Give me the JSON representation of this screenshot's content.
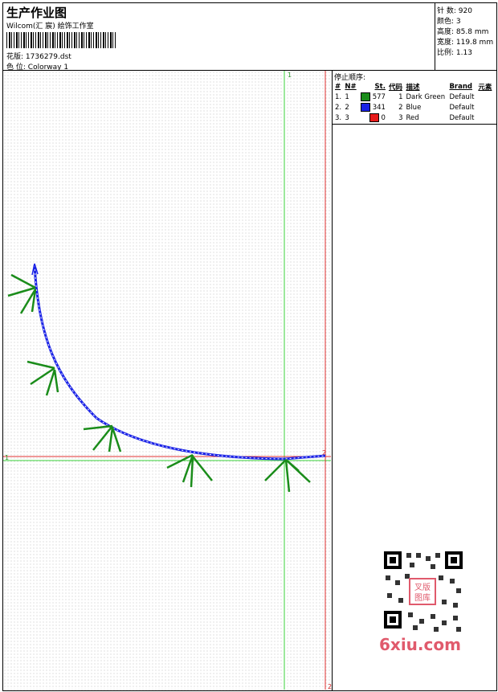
{
  "header": {
    "title": "生产作业图",
    "subtitle": "Wilcom(汇 宸) 絵饰工作室",
    "design_label": "花版:",
    "design_file": "1736279.dst",
    "colorway_label": "色 位:",
    "colorway": "Colorway 1"
  },
  "info": {
    "stitches_label": "针 数:",
    "stitches": "920",
    "colors_label": "颜色:",
    "colors": "3",
    "height_label": "高度:",
    "height": "85.8 mm",
    "width_label": "宽度:",
    "width": "119.8 mm",
    "scale_label": "比例:",
    "scale": "1.13"
  },
  "stop_sequence": {
    "title": "停止顺序:",
    "columns": [
      "#",
      "N#",
      "St.",
      "代码",
      "描述",
      "Brand",
      "元素"
    ],
    "rows": [
      {
        "idx": "1.",
        "n": "1",
        "color": "#1a8c1a",
        "stitches": "577",
        "code": "1",
        "desc": "Dark Green",
        "brand": "Default"
      },
      {
        "idx": "2.",
        "n": "2",
        "color": "#1a22e6",
        "stitches": "341",
        "code": "2",
        "desc": "Blue",
        "brand": "Default"
      },
      {
        "idx": "3.",
        "n": "3",
        "color": "#e61a1a",
        "stitches": "0",
        "code": "3",
        "desc": "Red",
        "brand": "Default"
      }
    ]
  },
  "guides": {
    "green_v": "1",
    "green_h": "1",
    "red_v": "2",
    "red_h": "2"
  },
  "watermark": {
    "badge_line1": "叉版",
    "badge_line2": "图库",
    "site": "6xiu.com"
  }
}
